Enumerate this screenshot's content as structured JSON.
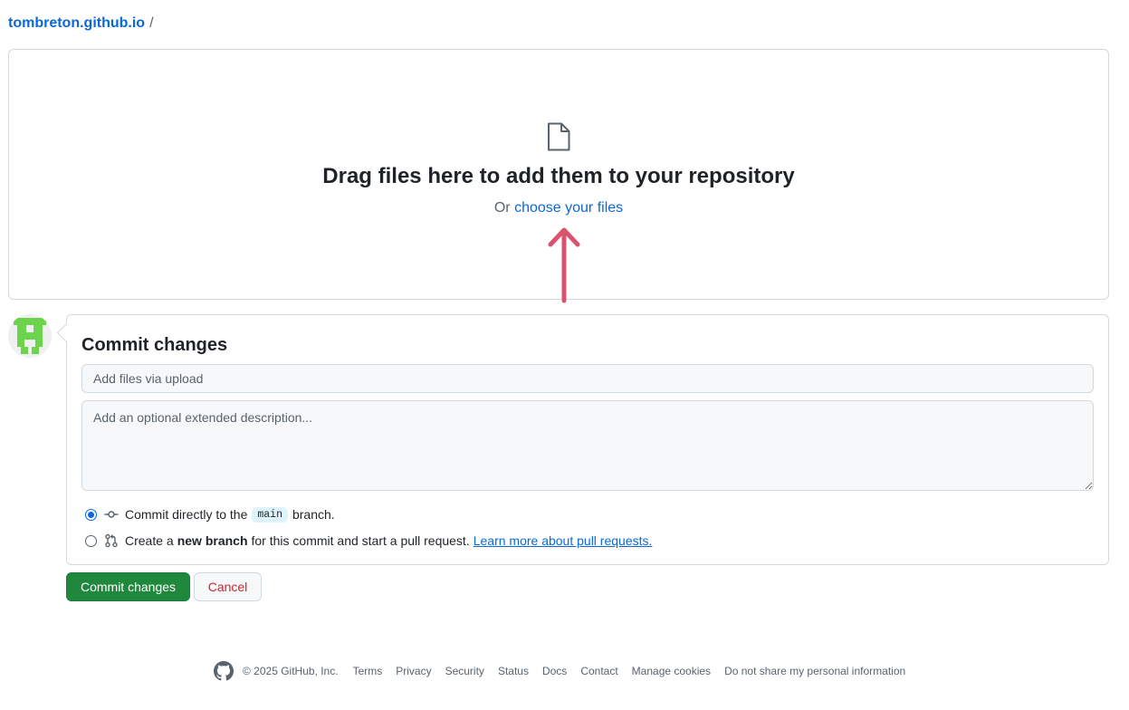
{
  "breadcrumb": {
    "repo": "tombreton.github.io",
    "separator": "/"
  },
  "dropzone": {
    "icon": "file-icon",
    "title": "Drag files here to add them to your repository",
    "prefix": "Or",
    "link_label": "choose your files",
    "annotation_icon": "up-arrow-icon",
    "annotation_color": "#d9536e"
  },
  "commit": {
    "title": "Commit changes",
    "summary_placeholder": "Add files via upload",
    "description_placeholder": "Add an optional extended description...",
    "option_direct": {
      "prefix": "Commit directly to the",
      "branch": "main",
      "suffix": "branch.",
      "checked": true
    },
    "option_new": {
      "prefix": "Create a",
      "bold": "new branch",
      "suffix": "for this commit and start a pull request.",
      "link": "Learn more about pull requests.",
      "checked": false
    }
  },
  "buttons": {
    "commit": "Commit changes",
    "cancel": "Cancel"
  },
  "footer": {
    "copyright": "© 2025 GitHub, Inc.",
    "links": [
      "Terms",
      "Privacy",
      "Security",
      "Status",
      "Docs",
      "Contact",
      "Manage cookies",
      "Do not share my personal information"
    ]
  },
  "colors": {
    "link": "#0969da",
    "primary_button": "#1f883d",
    "danger_text": "#d1242f",
    "border": "#d1d9e0"
  }
}
